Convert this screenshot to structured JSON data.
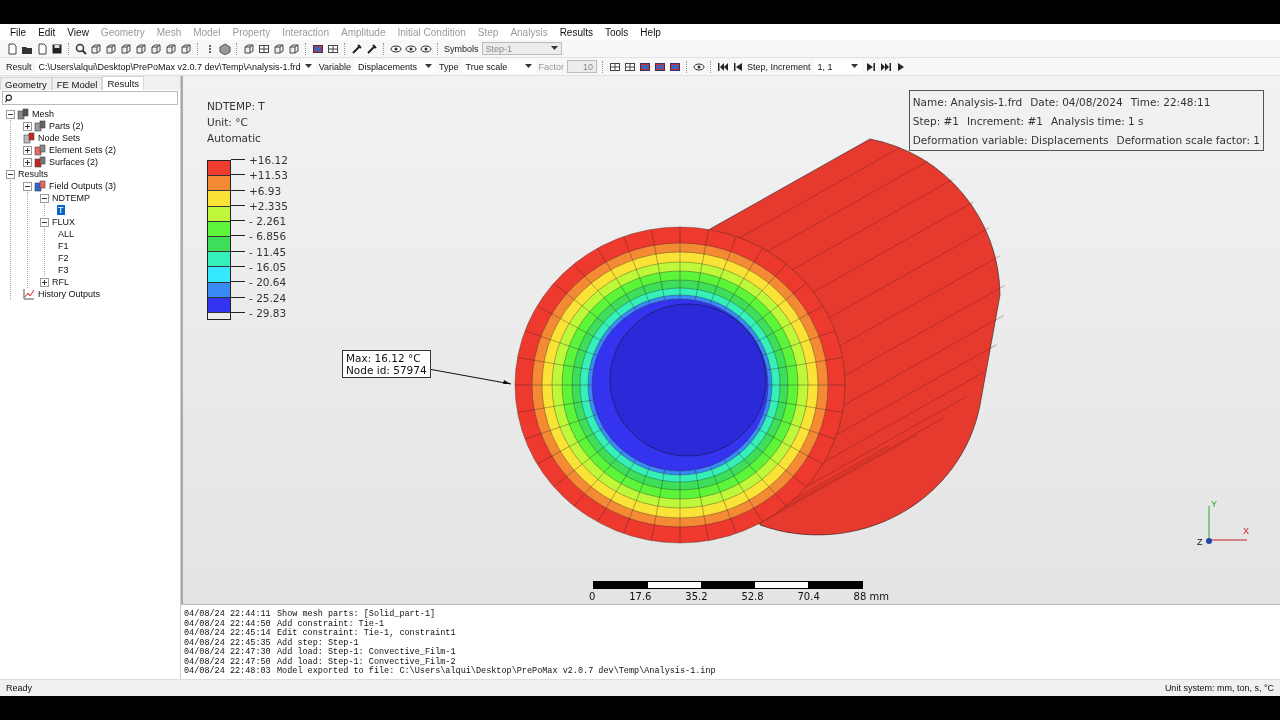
{
  "menu": [
    {
      "label": "File",
      "disabled": false
    },
    {
      "label": "Edit",
      "disabled": false
    },
    {
      "label": "View",
      "disabled": false
    },
    {
      "label": "Geometry",
      "disabled": true
    },
    {
      "label": "Mesh",
      "disabled": true
    },
    {
      "label": "Model",
      "disabled": true
    },
    {
      "label": "Property",
      "disabled": true
    },
    {
      "label": "Interaction",
      "disabled": true
    },
    {
      "label": "Amplitude",
      "disabled": true
    },
    {
      "label": "Initial Condition",
      "disabled": true
    },
    {
      "label": "Step",
      "disabled": true
    },
    {
      "label": "Analysis",
      "disabled": true
    },
    {
      "label": "Results",
      "disabled": false
    },
    {
      "label": "Tools",
      "disabled": false
    },
    {
      "label": "Help",
      "disabled": false
    }
  ],
  "toolbar": {
    "symbols_label": "Symbols",
    "symbols_value": "Step-1"
  },
  "result_bar": {
    "result_label": "Result",
    "result_value": "C:\\Users\\alqui\\Desktop\\PrePoMax v2.0.7 dev\\Temp\\Analysis-1.frd",
    "variable_label": "Variable",
    "variable_value": "Displacements",
    "type_label": "Type",
    "type_value": "True scale",
    "factor_label": "Factor",
    "factor_value": "10",
    "factor_disabled": true,
    "step_label": "Step, Increment",
    "step_value": "1, 1"
  },
  "tabs": [
    {
      "label": "Geometry",
      "selected": false
    },
    {
      "label": "FE Model",
      "selected": false
    },
    {
      "label": "Results",
      "selected": true
    }
  ],
  "tree": [
    {
      "label": "Mesh",
      "kind": "mesh",
      "expanded": true,
      "selected": false,
      "children": [
        {
          "label": "Parts (2)",
          "kind": "parts",
          "expanded": false,
          "selected": false
        },
        {
          "label": "Node Sets",
          "kind": "nodesets",
          "selected": false
        },
        {
          "label": "Element Sets (2)",
          "kind": "elementsets",
          "expanded": false,
          "selected": false
        },
        {
          "label": "Surfaces (2)",
          "kind": "surfaces",
          "expanded": false,
          "selected": false
        }
      ]
    },
    {
      "label": "Results",
      "expanded": true,
      "selected": false,
      "children": [
        {
          "label": "Field Outputs (3)",
          "kind": "field",
          "expanded": true,
          "selected": false,
          "children": [
            {
              "label": "NDTEMP",
              "expanded": true,
              "selected": false,
              "children": [
                {
                  "label": "T",
                  "selected": true
                }
              ]
            },
            {
              "label": "FLUX",
              "expanded": true,
              "selected": false,
              "children": [
                {
                  "label": "ALL",
                  "selected": false
                },
                {
                  "label": "F1",
                  "selected": false
                },
                {
                  "label": "F2",
                  "selected": false
                },
                {
                  "label": "F3",
                  "selected": false
                }
              ]
            },
            {
              "label": "RFL",
              "expanded": false,
              "selected": false
            }
          ]
        },
        {
          "label": "History Outputs",
          "kind": "history",
          "selected": false
        }
      ]
    }
  ],
  "viewport": {
    "legend": {
      "title": "NDTEMP: T",
      "unit": "Unit: °C",
      "mode": "Automatic",
      "labels": [
        "+16.12",
        "+11.53",
        "+6.93",
        "+2.335",
        "- 2.261",
        "- 6.856",
        "- 11.45",
        "- 16.05",
        "- 20.64",
        "- 25.24",
        "- 29.83"
      ],
      "bands": [
        {
          "color": "#f03c30"
        },
        {
          "color": "#f58a35"
        },
        {
          "color": "#fbe236"
        },
        {
          "color": "#bff83a"
        },
        {
          "color": "#5cf53a"
        },
        {
          "color": "#3ede5a"
        },
        {
          "color": "#35f0b8"
        },
        {
          "color": "#35e8fb"
        },
        {
          "color": "#3a8af5"
        },
        {
          "color": "#3434f0"
        }
      ]
    },
    "info": [
      [
        "Name: Analysis-1.frd",
        "Date: 04/08/2024",
        "Time: 22:48:11"
      ],
      [
        "Step: #1",
        "Increment: #1",
        "Analysis time: 1 s"
      ],
      [
        "Deformation variable: Displacements",
        "Deformation scale factor: 1"
      ]
    ],
    "annotation": [
      "Max: 16.12 °C",
      "Node id: 57974"
    ],
    "scale_ticks": [
      "0",
      "17.6",
      "35.2",
      "52.8",
      "70.4",
      "88 mm"
    ],
    "axes": {
      "x": "X",
      "y": "Y",
      "z": "Z"
    }
  },
  "log": [
    [
      "04/08/24 22:44:11",
      "Show mesh parts: [Solid_part-1]"
    ],
    [
      "04/08/24 22:44:50",
      "Add constraint: Tie-1"
    ],
    [
      "04/08/24 22:45:14",
      "Edit constraint: Tie-1, constraint1"
    ],
    [
      "04/08/24 22:45:35",
      "Add step: Step-1"
    ],
    [
      "04/08/24 22:47:30",
      "Add load: Step-1: Convective_Film-1"
    ],
    [
      "04/08/24 22:47:50",
      "Add load: Step-1: Convective_Film-2"
    ],
    [
      "04/08/24 22:48:03",
      "Model exported to file: C:\\Users\\alqui\\Desktop\\PrePoMax v2.0.7 dev\\Temp\\Analysis-1.inp"
    ]
  ],
  "status_bar": {
    "left": "Ready",
    "right": "Unit system: mm, ton, s, °C"
  }
}
